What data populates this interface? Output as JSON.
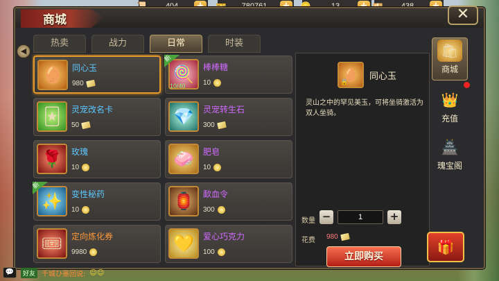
{
  "currencies": [
    {
      "icon": "scroll-icon",
      "value": "404"
    },
    {
      "icon": "ticket-icon",
      "value": "780761"
    },
    {
      "icon": "coin-icon",
      "value": "13"
    },
    {
      "icon": "gold-bar-icon",
      "value": "438"
    }
  ],
  "shop": {
    "title": "商城"
  },
  "tabs": [
    {
      "label": "热卖"
    },
    {
      "label": "战力"
    },
    {
      "label": "日常",
      "active": true
    },
    {
      "label": "时装"
    }
  ],
  "items": [
    {
      "name": "同心玉",
      "price": "980",
      "currency": "bill",
      "color": "blue",
      "selected": true,
      "icon": "orange"
    },
    {
      "name": "棒棒糖",
      "price": "10",
      "currency": "coin",
      "color": "purple",
      "badge": "新",
      "stock": "10/40",
      "icon": "pink"
    },
    {
      "name": "灵宠改名卡",
      "price": "50",
      "currency": "bill",
      "color": "blue",
      "icon": "green"
    },
    {
      "name": "灵宠转生石",
      "price": "300",
      "currency": "bill",
      "color": "purple",
      "icon": "teal"
    },
    {
      "name": "玫瑰",
      "price": "10",
      "currency": "coin",
      "color": "blue",
      "icon": "red"
    },
    {
      "name": "肥皂",
      "price": "10",
      "currency": "coin",
      "color": "purple",
      "icon": "gold"
    },
    {
      "name": "变性秘药",
      "price": "10",
      "currency": "coin",
      "color": "blue",
      "badge": "新",
      "icon": "blue"
    },
    {
      "name": "歃血令",
      "price": "300",
      "currency": "coin",
      "color": "purple",
      "icon": "brown"
    },
    {
      "name": "定向炼化券",
      "price": "9980",
      "currency": "coin",
      "color": "orange",
      "icon": "red"
    },
    {
      "name": "爱心巧克力",
      "price": "100",
      "currency": "coin",
      "color": "purple",
      "icon": "yellow"
    }
  ],
  "detail": {
    "name": "同心玉",
    "description": "灵山之中的罕见美玉，可将坐骑激活为双人坐骑。",
    "quantity_label": "数量",
    "quantity": "1",
    "cost_label": "花费",
    "cost": "980",
    "buy_label": "立即购买"
  },
  "side_nav": [
    {
      "label": "商城",
      "icon": "shop-icon",
      "active": true
    },
    {
      "label": "充值",
      "icon": "recharge-icon"
    },
    {
      "label": "瑰宝阁",
      "icon": "treasure-icon"
    }
  ],
  "chat": {
    "channel": "好友",
    "message": "千城ひ墨回说:"
  },
  "colors": {
    "accent": "#e79a2a",
    "buy": "#d83a22"
  }
}
